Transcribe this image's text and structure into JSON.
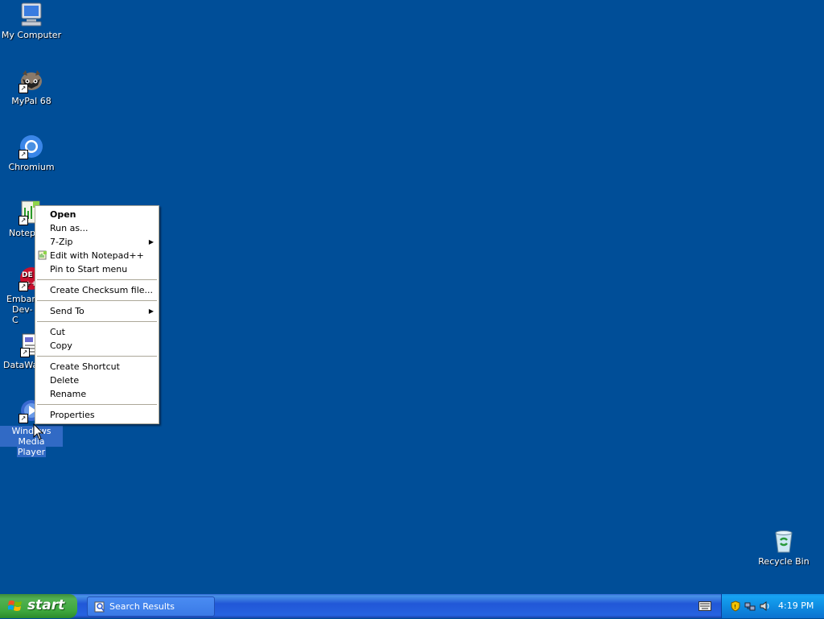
{
  "desktop": {
    "icons": [
      {
        "label": "My Computer",
        "icon": "my-computer-icon"
      },
      {
        "label": "MyPal 68",
        "icon": "mypal-icon"
      },
      {
        "label": "Chromium",
        "icon": "chromium-icon"
      },
      {
        "label": "Notepa",
        "icon": "notepadpp-icon"
      },
      {
        "label": "Embarc",
        "label2": "Dev-C",
        "icon": "devcpp-icon"
      },
      {
        "label": "DataWa",
        "icon": "datawatch-icon"
      },
      {
        "label": "Windows Media",
        "label2": "Player",
        "icon": "windows-media-player-icon"
      },
      {
        "label": "Recycle Bin",
        "icon": "recycle-bin-icon"
      }
    ]
  },
  "context_menu": {
    "items": [
      {
        "label": "Open",
        "bold": true
      },
      {
        "label": "Run as..."
      },
      {
        "label": "7-Zip",
        "submenu": true
      },
      {
        "label": "Edit with Notepad++",
        "icon": "notepadpp-mini-icon"
      },
      {
        "label": "Pin to Start menu"
      },
      {
        "separator": true
      },
      {
        "label": "Create Checksum file..."
      },
      {
        "separator": true
      },
      {
        "label": "Send To",
        "submenu": true
      },
      {
        "separator": true
      },
      {
        "label": "Cut"
      },
      {
        "label": "Copy"
      },
      {
        "separator": true
      },
      {
        "label": "Create Shortcut"
      },
      {
        "label": "Delete"
      },
      {
        "label": "Rename"
      },
      {
        "separator": true
      },
      {
        "label": "Properties"
      }
    ]
  },
  "taskbar": {
    "start_label": "start",
    "tasks": [
      {
        "label": "Search Results",
        "icon": "search-results-icon"
      }
    ],
    "clock": "4:19 PM",
    "tray_icons": [
      "security-shield-icon",
      "network-icon",
      "speaker-icon"
    ]
  },
  "colors": {
    "desktop_background": "#004e98",
    "selection": "#316ac5",
    "taskbar_blue": "#2157d7",
    "start_green": "#3da73d"
  }
}
